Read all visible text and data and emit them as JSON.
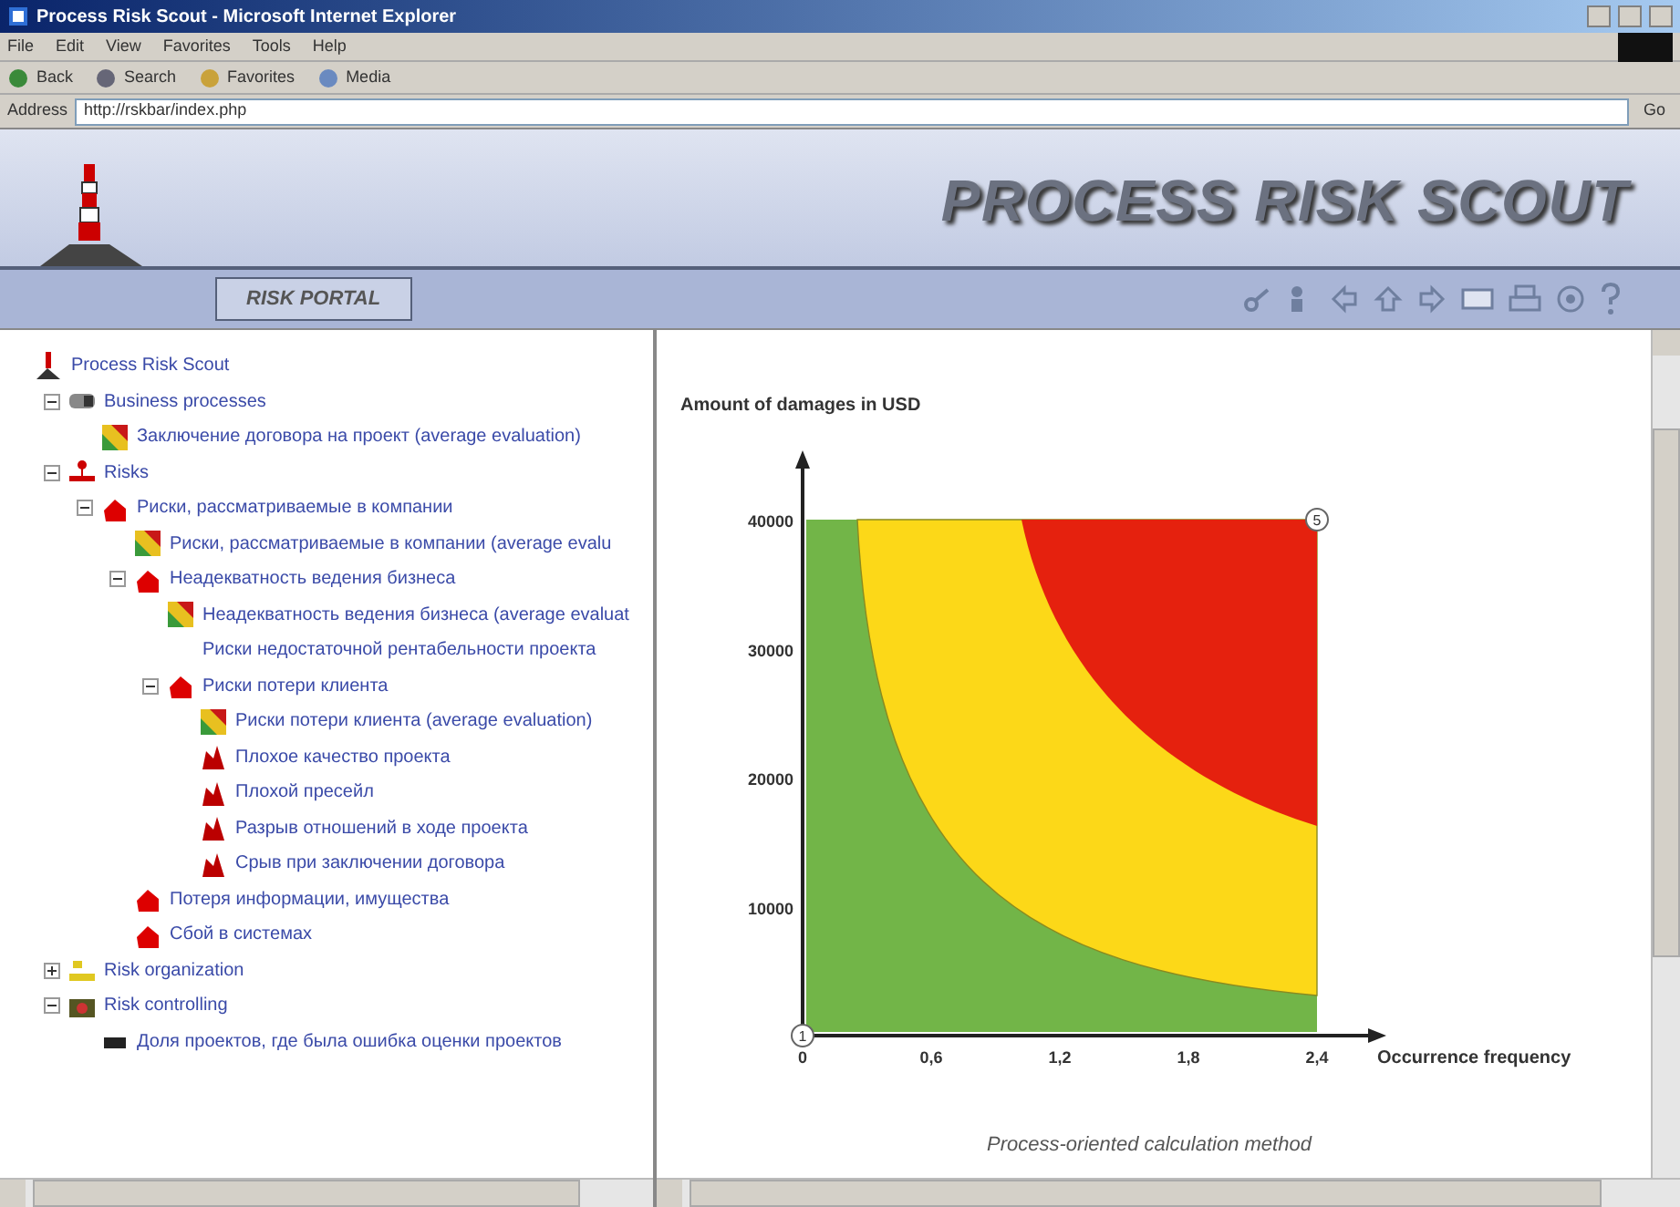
{
  "window": {
    "title": "Process Risk Scout - Microsoft Internet Explorer"
  },
  "menu": [
    "File",
    "Edit",
    "View",
    "Favorites",
    "Tools",
    "Help"
  ],
  "toolbar": [
    "Back",
    "Search",
    "Favorites",
    "Media"
  ],
  "address": {
    "label": "Address",
    "value": "http://rskbar/index.php",
    "go": "Go"
  },
  "header": {
    "title": "PROCESS RISK SCOUT",
    "portal": "RISK PORTAL"
  },
  "tree": [
    {
      "label": "Process Risk Scout",
      "kind": "root",
      "children": [
        {
          "label": "Business processes",
          "kind": "process",
          "expanded": true,
          "children": [
            {
              "label": "Заключение договора на проект (average evaluation)",
              "kind": "evaluation"
            }
          ]
        },
        {
          "label": "Risks",
          "kind": "risks",
          "expanded": true,
          "children": [
            {
              "label": "Риски, рассматриваемые в компании",
              "kind": "group",
              "expanded": true,
              "children": [
                {
                  "label": "Риски, рассматриваемые в компании (average evalu",
                  "kind": "evaluation"
                },
                {
                  "label": "Неадекватность ведения бизнеса",
                  "kind": "group",
                  "expanded": true,
                  "children": [
                    {
                      "label": "Неадекватность ведения бизнеса (average evaluat",
                      "kind": "evaluation"
                    },
                    {
                      "label": "Риски недостаточной рентабельности проекта",
                      "kind": "plain"
                    },
                    {
                      "label": "Риски потери клиента",
                      "kind": "group",
                      "expanded": true,
                      "children": [
                        {
                          "label": "Риски потери клиента (average evaluation)",
                          "kind": "evaluation"
                        },
                        {
                          "label": "Плохое качество проекта",
                          "kind": "risk"
                        },
                        {
                          "label": "Плохой пресейл",
                          "kind": "risk"
                        },
                        {
                          "label": "Разрыв отношений в ходе проекта",
                          "kind": "risk"
                        },
                        {
                          "label": "Срыв при заключении договора",
                          "kind": "risk"
                        }
                      ]
                    }
                  ]
                },
                {
                  "label": "Потеря информации, имущества",
                  "kind": "group"
                },
                {
                  "label": "Сбой в системах",
                  "kind": "group"
                }
              ]
            }
          ]
        },
        {
          "label": "Risk organization",
          "kind": "organization",
          "expanded": false
        },
        {
          "label": "Risk controlling",
          "kind": "controlling",
          "expanded": true,
          "children": [
            {
              "label": "Доля проектов, где была ошибка оценки проектов",
              "kind": "indicator"
            }
          ]
        }
      ]
    }
  ],
  "chart": {
    "ylabel": "Amount of damages in USD",
    "xlabel": "Occurrence frequency",
    "yticks": [
      "40000",
      "30000",
      "20000",
      "10000"
    ],
    "xticks": [
      "0",
      "0,6",
      "1,2",
      "1,8",
      "2,4"
    ],
    "markers": [
      "1",
      "5"
    ],
    "caption": "Process-oriented calculation method"
  }
}
